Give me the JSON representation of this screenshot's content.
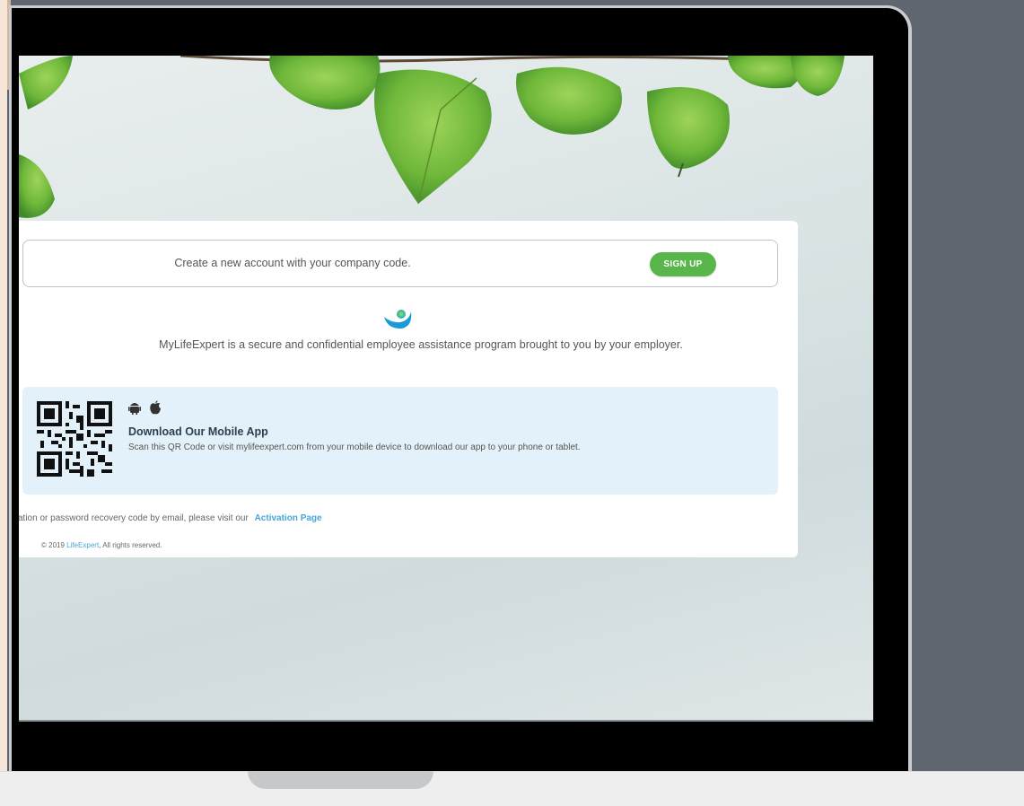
{
  "signup": {
    "text": "Create a new account with your company code.",
    "button_label": "SIGN UP"
  },
  "tagline": "MyLifeExpert is a secure and confidential employee assistance program brought to you by your employer.",
  "mobile_app": {
    "icons": [
      "android-icon",
      "apple-icon"
    ],
    "title": "Download Our Mobile App",
    "description": "Scan this QR Code or visit mylifeexpert.com from your mobile device to download our app to your phone or tablet."
  },
  "activation": {
    "text": "vation or password recovery code by email, please visit our",
    "link_label": "Activation Page"
  },
  "footer": {
    "prefix": "© 2019",
    "link": "LifeExpert",
    "suffix": ", All rights reserved."
  },
  "colors": {
    "accent_green": "#59b64a",
    "link_blue": "#4aa6d8",
    "app_box_bg": "#e3f2fa",
    "logo_blue": "#1a9ad6"
  }
}
